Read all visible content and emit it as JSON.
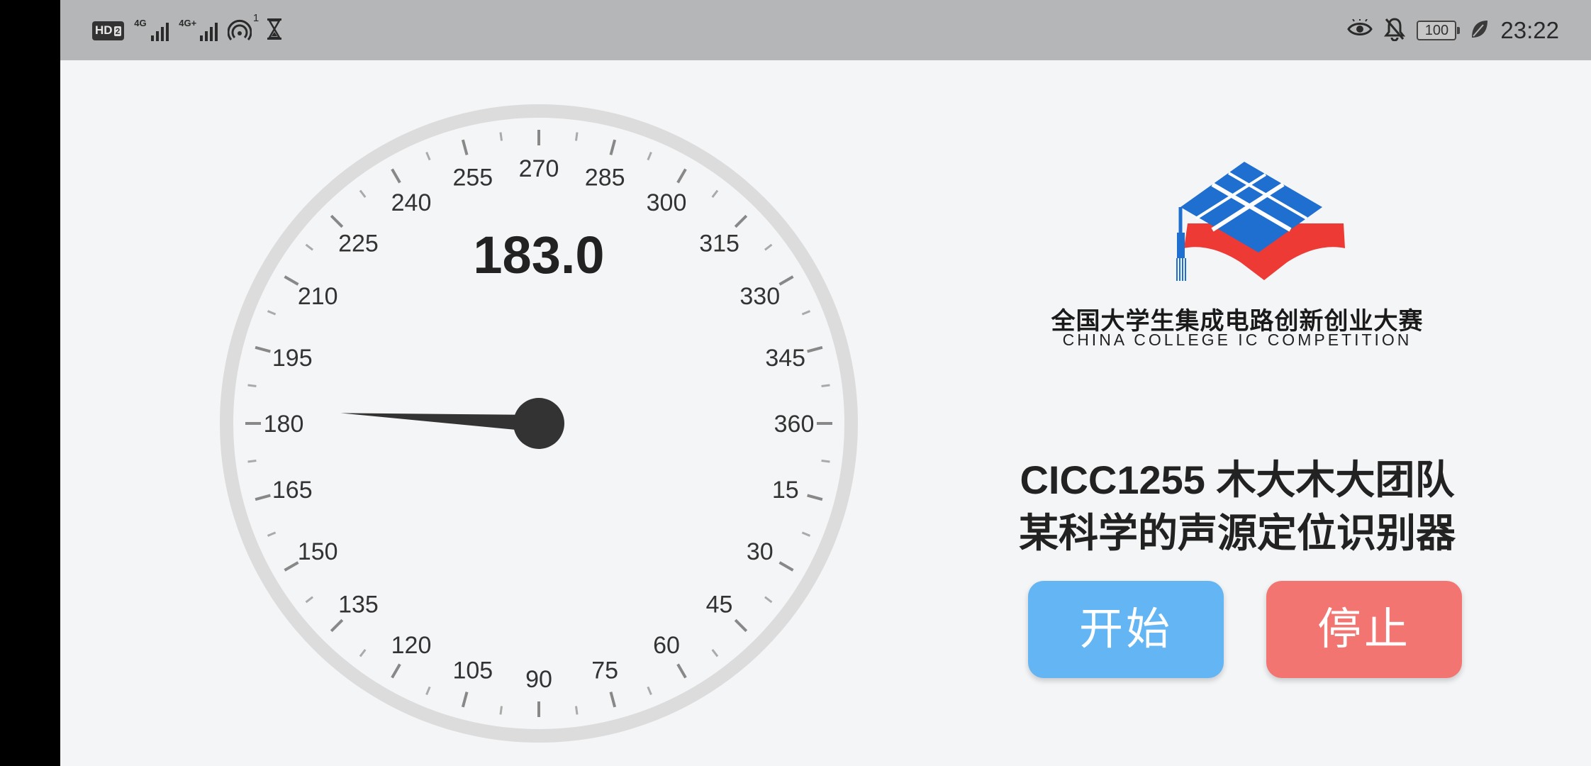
{
  "status_bar": {
    "hd_label": "HD",
    "hd_sub": "2",
    "net1_label": "4G",
    "net2_label": "4G+",
    "hotspot_count": "1",
    "battery": "100",
    "time": "23:22"
  },
  "gauge": {
    "value": 183.0,
    "display": "183.0",
    "tick_labels": [
      "270",
      "285",
      "300",
      "315",
      "330",
      "345",
      "360",
      "15",
      "30",
      "45",
      "60",
      "75",
      "90",
      "105",
      "120",
      "135",
      "150",
      "165",
      "180",
      "195",
      "210",
      "225",
      "240",
      "255"
    ]
  },
  "logo": {
    "cn_text": "全国大学生集成电路创新创业大赛",
    "en_text": "CHINA COLLEGE IC COMPETITION"
  },
  "title": {
    "line1": "CICC1255 木大木大团队",
    "line2": "某科学的声源定位识别器"
  },
  "buttons": {
    "start_label": "开始",
    "stop_label": "停止"
  },
  "colors": {
    "start_button": "#64b5f4",
    "stop_button": "#f37571",
    "logo_blue": "#1e6fd0",
    "logo_red": "#ee3a34",
    "needle": "#333333"
  }
}
